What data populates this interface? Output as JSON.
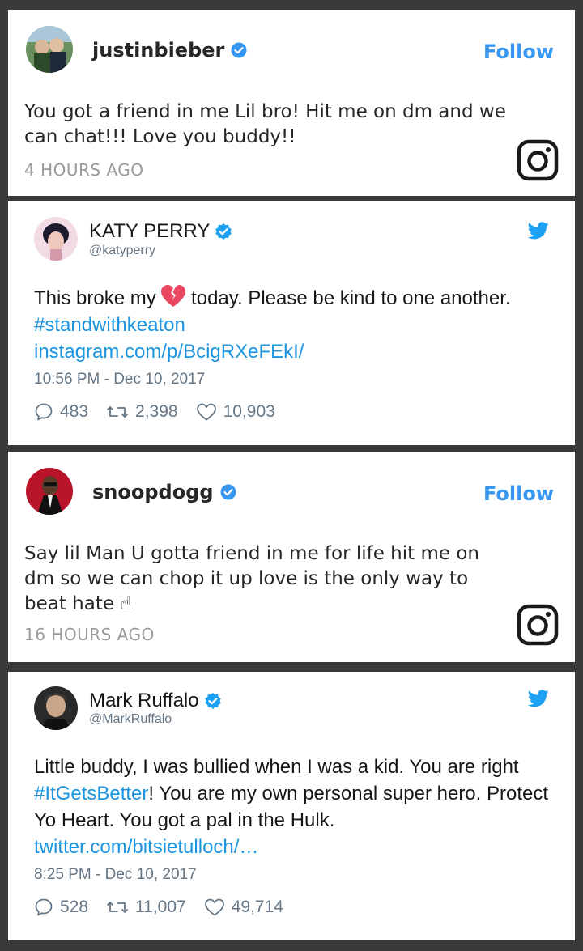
{
  "posts": [
    {
      "platform": "instagram",
      "username": "justinbieber",
      "follow_label": "Follow",
      "text": "You got a friend in me Lil bro! Hit me on dm and we can chat!!! Love you buddy!!",
      "time": "4 HOURS AGO"
    },
    {
      "platform": "twitter",
      "display_name": "KATY PERRY",
      "handle": "@katyperry",
      "text_before": "This broke my",
      "emoji": "broken-heart",
      "text_after": "today. Please be kind to one another.",
      "hashtag": "#standwithkeaton",
      "link": "instagram.com/p/BcigRXeFEkI/",
      "timestamp": "10:56 PM - Dec 10, 2017",
      "replies": "483",
      "retweets": "2,398",
      "likes": "10,903"
    },
    {
      "platform": "instagram",
      "username": "snoopdogg",
      "follow_label": "Follow",
      "text": "Say lil Man U gotta friend in me for life hit me on dm so we can chop it up love is the only way to beat hate ☝",
      "time": "16 HOURS AGO"
    },
    {
      "platform": "twitter",
      "display_name": "Mark Ruffalo",
      "handle": "@MarkRuffalo",
      "text_before": "Little buddy, I was bullied when I was a kid. You are right",
      "hashtag": "#ItGetsBetter",
      "text_after": "! You are my own personal super hero. Protect Yo Heart. You got a pal in the Hulk.",
      "link": "twitter.com/bitsietulloch/…",
      "timestamp": "8:25 PM - Dec 10, 2017",
      "replies": "528",
      "retweets": "11,007",
      "likes": "49,714"
    }
  ],
  "colors": {
    "instagram_blue": "#3897f0",
    "twitter_blue": "#1da1f2",
    "link_blue": "#1b95e0",
    "verified_blue": "#3897f0"
  }
}
